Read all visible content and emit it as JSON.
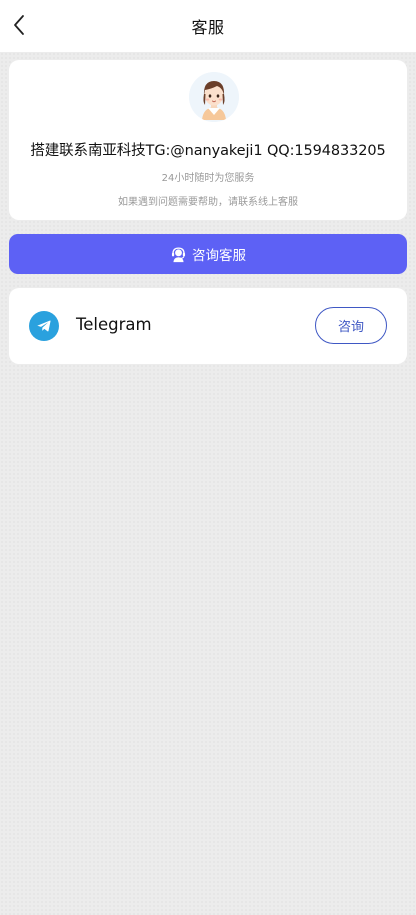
{
  "header": {
    "title": "客服",
    "back_icon": "chevron-left-icon"
  },
  "profile": {
    "avatar_icon": "customer-service-avatar",
    "contact_line": "搭建联系南亚科技TG:@nanyakeji1 QQ:1594833205",
    "service_hours": "24小时随时为您服务",
    "help_text": "如果遇到问题需要帮助，请联系线上客服"
  },
  "consult_button": {
    "label": "咨询客服",
    "icon": "headset-icon",
    "color": "#5d61f5"
  },
  "channels": [
    {
      "name": "Telegram",
      "icon": "telegram-icon",
      "icon_color": "#2aa1de",
      "button_label": "咨询",
      "button_color": "#3f58c4"
    }
  ]
}
